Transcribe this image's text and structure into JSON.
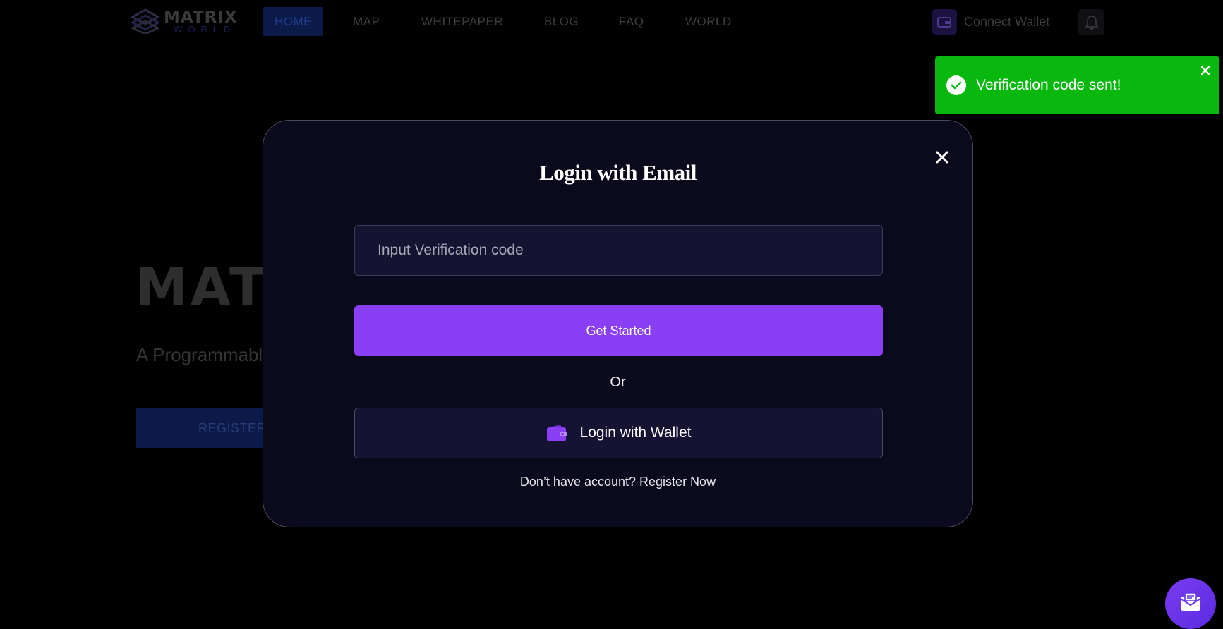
{
  "nav": {
    "logo_text": "MATRIX",
    "logo_sub": "WORLD",
    "items": [
      {
        "label": "HOME"
      },
      {
        "label": "MAP"
      },
      {
        "label": "WHITEPAPER"
      },
      {
        "label": "BLOG"
      },
      {
        "label": "FAQ"
      },
      {
        "label": "WORLD"
      }
    ],
    "connect_wallet": "Connect Wallet"
  },
  "hero": {
    "title": "MAT",
    "subtitle": "A Programmabl",
    "register_label": "REGISTER"
  },
  "modal": {
    "title": "Login with Email",
    "code_placeholder": "Input Verification code",
    "code_value": "",
    "get_started_label": "Get Started",
    "or_label": "Or",
    "wallet_login_label": "Login with Wallet",
    "no_account_text": "Don’t have account?",
    "register_link": "Register Now"
  },
  "toast": {
    "message": "Verification code sent!"
  },
  "colors": {
    "accent": "#8a3ff5",
    "toast_success": "#09b80f",
    "modal_bg": "#0b0a1c",
    "input_bg": "#151232"
  }
}
